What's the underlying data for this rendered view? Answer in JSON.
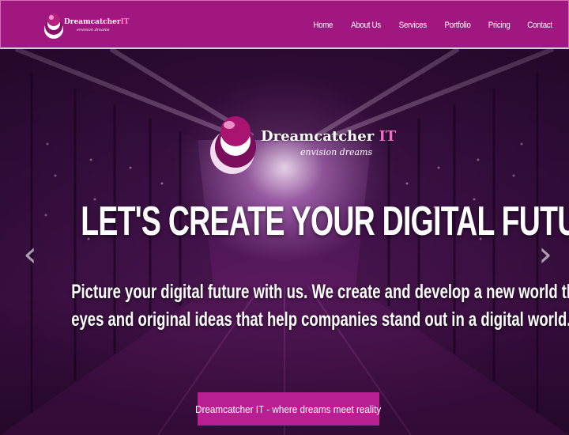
{
  "navbar": {
    "logo": {
      "brand": "Dreamcatcher",
      "brand_suffix": "IT",
      "tagline": "envision dreams"
    },
    "links": [
      {
        "label": "Home"
      },
      {
        "label": "About Us"
      },
      {
        "label": "Services"
      },
      {
        "label": "Portfolio"
      },
      {
        "label": "Pricing"
      },
      {
        "label": "Contact"
      }
    ],
    "background_color": "#a0187f"
  },
  "hero": {
    "logo": {
      "brand": "Dreamcatcher",
      "brand_suffix": "IT",
      "tagline": "envision dreams"
    },
    "title": "LET'S CREATE YOUR DIGITAL FUTURE",
    "description_line1": "Picture your digital future with us. We create and develop a new world through our creative",
    "description_line2": "eyes and original ideas that help companies stand out in a digital world.",
    "cta_label": "Dreamcatcher IT - where dreams meet reality",
    "prev_icon": "chevron-left-icon",
    "next_icon": "chevron-right-icon",
    "accent_color": "#b91f92"
  }
}
